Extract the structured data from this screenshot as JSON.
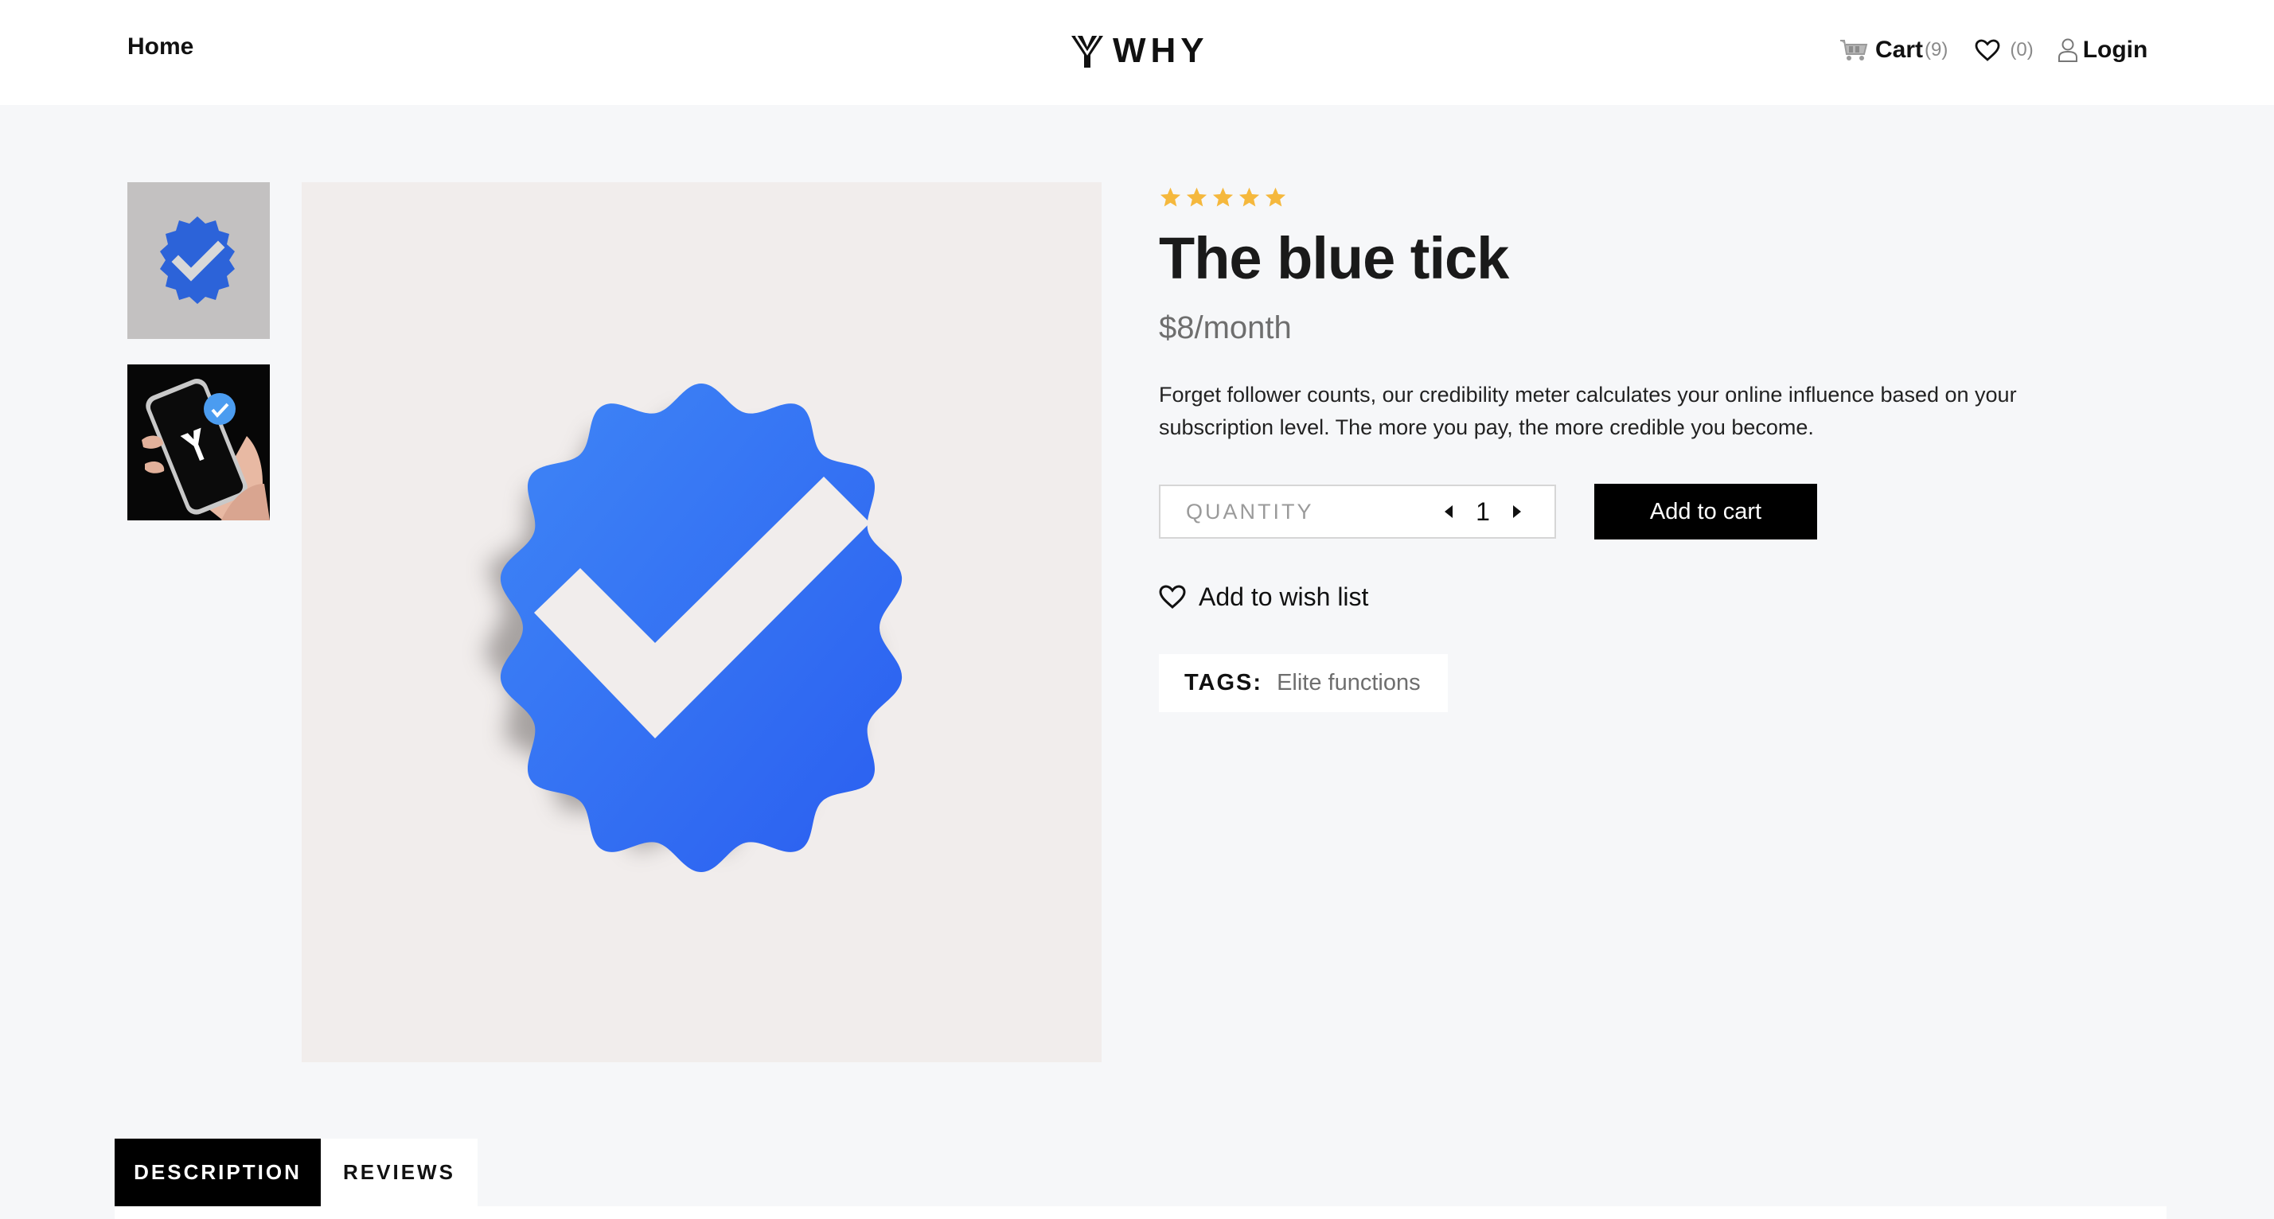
{
  "header": {
    "home_label": "Home",
    "brand": "WHY",
    "cart_label": "Cart",
    "cart_count": "(9)",
    "wishlist_count": "(0)",
    "login_label": "Login"
  },
  "product": {
    "rating_stars": 5,
    "title": "The blue tick",
    "price": "$8/month",
    "description": "Forget follower counts, our credibility meter calculates your online influence based on your subscription level. The more you pay, the more credible you become.",
    "quantity_label": "QUANTITY",
    "quantity_value": "1",
    "add_to_cart_label": "Add to cart",
    "wishlist_label": "Add to wish list",
    "tags_label": "TAGS:",
    "tags_value": "Elite functions"
  },
  "tabs": [
    {
      "label": "DESCRIPTION",
      "active": true
    },
    {
      "label": "REVIEWS",
      "active": false
    }
  ],
  "colors": {
    "badge_blue": "#2f6df5",
    "star_gold": "#f5b83d",
    "button_black": "#000000",
    "page_bg": "#f6f7f9"
  }
}
